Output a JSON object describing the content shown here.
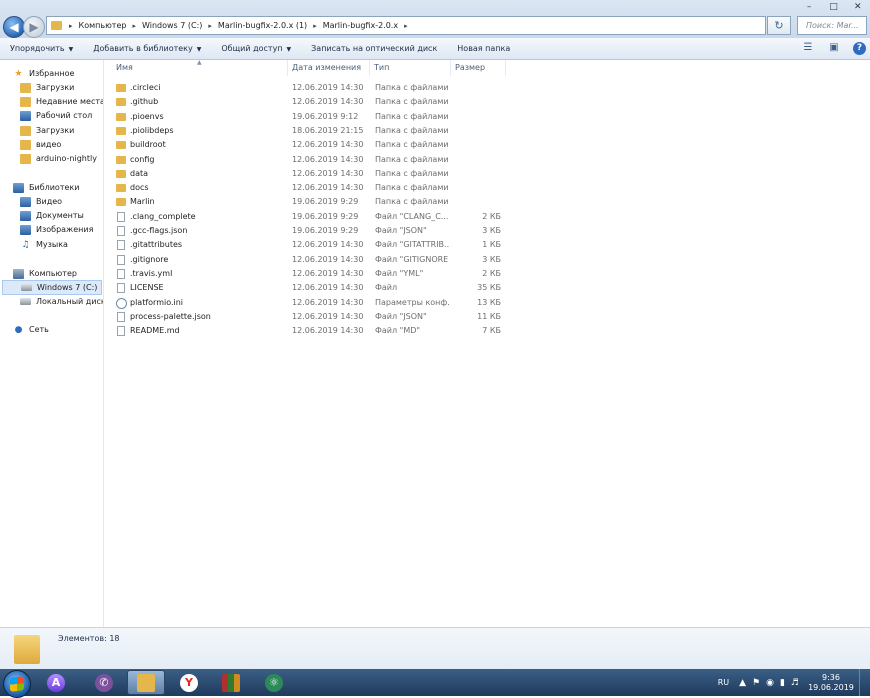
{
  "window_controls": {
    "minimize": "–",
    "maximize": "□",
    "close": "✕"
  },
  "address": {
    "crumbs": [
      "Компьютер",
      "Windows 7 (C:)",
      "Marlin-bugfix-2.0.x (1)",
      "Marlin-bugfix-2.0.x"
    ],
    "separator": "▸",
    "search_placeholder": "Поиск: Mar..."
  },
  "toolbar": {
    "organize": "Упорядочить",
    "add_library": "Добавить в библиотеку",
    "share": "Общий доступ",
    "burn": "Записать на оптический диск",
    "new_folder": "Новая папка"
  },
  "nav": {
    "favorites": "Избранное",
    "favorites_items": [
      "Загрузки",
      "Недавние места",
      "Рабочий стол",
      "Загрузки",
      "видео",
      "arduino-nightly"
    ],
    "libraries": "Библиотеки",
    "libraries_items": [
      "Видео",
      "Документы",
      "Изображения",
      "Музыка"
    ],
    "computer": "Компьютер",
    "computer_items": [
      "Windows 7 (C:)",
      "Локальный диск ("
    ],
    "network": "Сеть"
  },
  "columns": {
    "name": "Имя",
    "date": "Дата изменения",
    "type": "Тип",
    "size": "Размер"
  },
  "files": [
    {
      "name": ".circleci",
      "date": "12.06.2019 14:30",
      "type": "Папка с файлами",
      "size": "",
      "icon": "folder-icon"
    },
    {
      "name": ".github",
      "date": "12.06.2019 14:30",
      "type": "Папка с файлами",
      "size": "",
      "icon": "folder-icon"
    },
    {
      "name": ".pioenvs",
      "date": "19.06.2019 9:12",
      "type": "Папка с файлами",
      "size": "",
      "icon": "folder-icon"
    },
    {
      "name": ".piolibdeps",
      "date": "18.06.2019 21:15",
      "type": "Папка с файлами",
      "size": "",
      "icon": "folder-icon"
    },
    {
      "name": "buildroot",
      "date": "12.06.2019 14:30",
      "type": "Папка с файлами",
      "size": "",
      "icon": "folder-icon"
    },
    {
      "name": "config",
      "date": "12.06.2019 14:30",
      "type": "Папка с файлами",
      "size": "",
      "icon": "folder-icon"
    },
    {
      "name": "data",
      "date": "12.06.2019 14:30",
      "type": "Папка с файлами",
      "size": "",
      "icon": "folder-icon"
    },
    {
      "name": "docs",
      "date": "12.06.2019 14:30",
      "type": "Папка с файлами",
      "size": "",
      "icon": "folder-icon"
    },
    {
      "name": "Marlin",
      "date": "19.06.2019 9:29",
      "type": "Папка с файлами",
      "size": "",
      "icon": "folder-icon"
    },
    {
      "name": ".clang_complete",
      "date": "19.06.2019 9:29",
      "type": "Файл \"CLANG_C...",
      "size": "2 КБ",
      "icon": "file-icon"
    },
    {
      "name": ".gcc-flags.json",
      "date": "19.06.2019 9:29",
      "type": "Файл \"JSON\"",
      "size": "3 КБ",
      "icon": "file-icon"
    },
    {
      "name": ".gitattributes",
      "date": "12.06.2019 14:30",
      "type": "Файл \"GITATTRIB...",
      "size": "1 КБ",
      "icon": "file-icon"
    },
    {
      "name": ".gitignore",
      "date": "12.06.2019 14:30",
      "type": "Файл \"GITIGNORE\"",
      "size": "3 КБ",
      "icon": "file-icon"
    },
    {
      "name": ".travis.yml",
      "date": "12.06.2019 14:30",
      "type": "Файл \"YML\"",
      "size": "2 КБ",
      "icon": "file-icon"
    },
    {
      "name": "LICENSE",
      "date": "12.06.2019 14:30",
      "type": "Файл",
      "size": "35 КБ",
      "icon": "file-icon"
    },
    {
      "name": "platformio.ini",
      "date": "12.06.2019 14:30",
      "type": "Параметры конф...",
      "size": "13 КБ",
      "icon": "settings-file-icon"
    },
    {
      "name": "process-palette.json",
      "date": "12.06.2019 14:30",
      "type": "Файл \"JSON\"",
      "size": "11 КБ",
      "icon": "file-icon"
    },
    {
      "name": "README.md",
      "date": "12.06.2019 14:30",
      "type": "Файл \"MD\"",
      "size": "7 КБ",
      "icon": "file-icon"
    }
  ],
  "details": {
    "items_count": "Элементов: 18"
  },
  "taskbar": {
    "apps": [
      "alice-icon",
      "viber-icon",
      "explorer-icon",
      "yandex-browser-icon",
      "winrar-icon",
      "atom-icon"
    ],
    "lang": "RU",
    "time": "9:36",
    "date": "19.06.2019"
  },
  "colors": {
    "accent": "#2a66b4",
    "folder": "#e5b64b",
    "taskbar": "#1f3a5d"
  }
}
